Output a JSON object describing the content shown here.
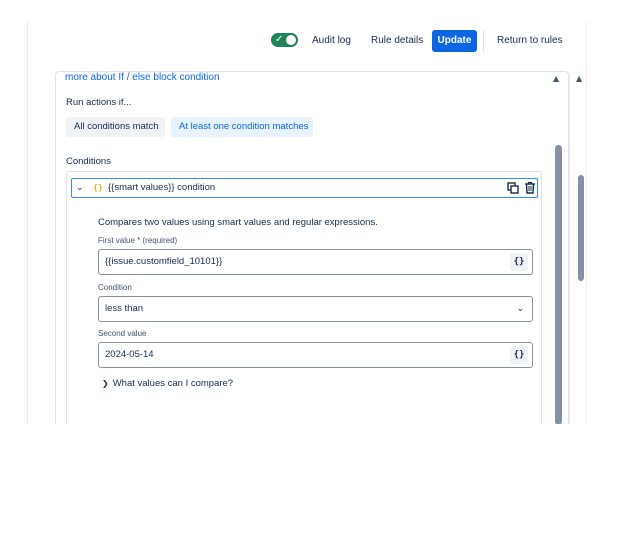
{
  "toolbar": {
    "toggle_state": "on",
    "audit_log": "Audit log",
    "rule_details": "Rule details",
    "update": "Update",
    "return_to_rules": "Return to rules"
  },
  "panel": {
    "learn_more_link": "more about If / else block condition",
    "run_actions_label": "Run actions if...",
    "match_options": [
      "All conditions match",
      "At least one condition matches"
    ],
    "selected_match_option": "At least one condition matches",
    "conditions_label": "Conditions"
  },
  "condition": {
    "badge": "{}",
    "title": "{{smart values}} condition",
    "description": "Compares two values using smart values and regular expressions.",
    "first_value_label": "First value",
    "required_marker": "*",
    "required_text": "(required)",
    "first_value": "{{issue.customfield_10101}}",
    "braces_button": "{}",
    "condition_label": "Condition",
    "condition_value": "less than",
    "second_value_label": "Second value",
    "second_value": "2024-05-14",
    "expander_label": "What values can I compare?"
  },
  "icons": {
    "toggle": "check-icon",
    "collapse": "chevron-down-icon",
    "copy": "copy-icon",
    "delete": "trash-icon",
    "select": "chevron-down-icon",
    "expander": "chevron-right-icon"
  },
  "colors": {
    "primary": "#0c66e4",
    "toggle_on": "#1f845a",
    "selected_segment_bg": "#e9f2ff",
    "focus_border": "#388bff",
    "smart_value_badge": "#e2b203"
  }
}
